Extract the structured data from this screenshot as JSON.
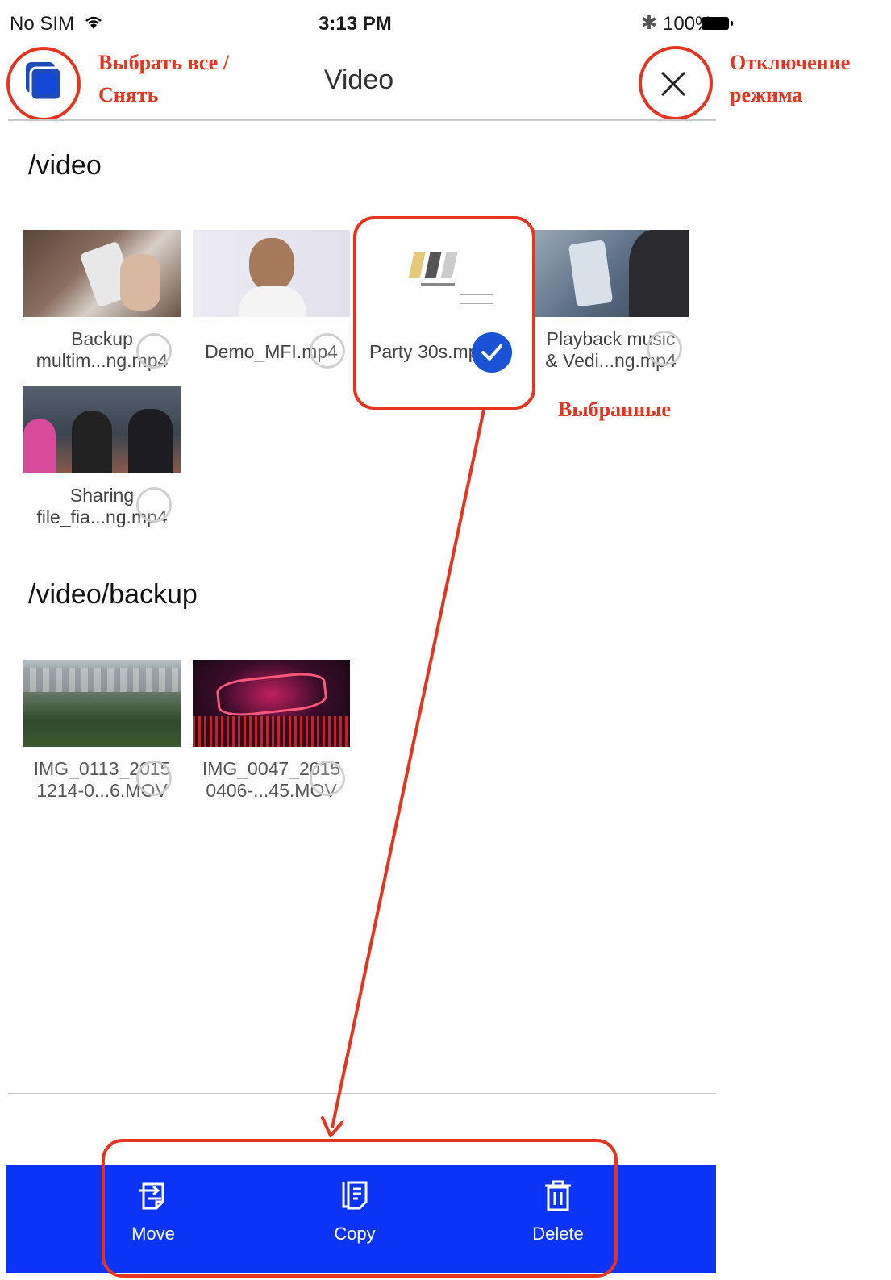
{
  "status_bar": {
    "carrier": "No SIM",
    "time": "3:13 PM",
    "battery": "100%"
  },
  "nav": {
    "title": "Video"
  },
  "annotations": {
    "select_all": "Выбрать все /",
    "deselect": "Снять",
    "exit_mode": "Отключение",
    "exit_mode_2": "режима",
    "selected": "Выбранные"
  },
  "sections": [
    {
      "title": "/video",
      "items": [
        {
          "line1": "Backup",
          "line2": "multim...ng.mp4",
          "selected": false
        },
        {
          "line1": "Demo_MFI.mp4",
          "line2": "",
          "selected": false
        },
        {
          "line1": "Party 30s.mp4",
          "line2": "",
          "selected": true
        },
        {
          "line1": "Playback music",
          "line2": "& Vedi...ng.mp4",
          "selected": false
        },
        {
          "line1": "Sharing",
          "line2": "file_fia...ng.mp4",
          "selected": false
        }
      ]
    },
    {
      "title": "/video/backup",
      "items": [
        {
          "line1": "IMG_0113_2015",
          "line2": "1214-0...6.MOV",
          "selected": false
        },
        {
          "line1": "IMG_0047_2015",
          "line2": "0406-...45.MOV",
          "selected": false
        }
      ]
    }
  ],
  "toolbar": {
    "move": "Move",
    "copy": "Copy",
    "delete": "Delete"
  },
  "colors": {
    "accent": "#0c34f6",
    "annotation": "#e5341f",
    "check": "#1a52d6"
  },
  "icons": {
    "select_all": "select-all-icon",
    "close": "close-icon",
    "move": "move-icon",
    "copy": "copy-icon",
    "delete": "trash-icon",
    "check": "checkmark-icon"
  }
}
